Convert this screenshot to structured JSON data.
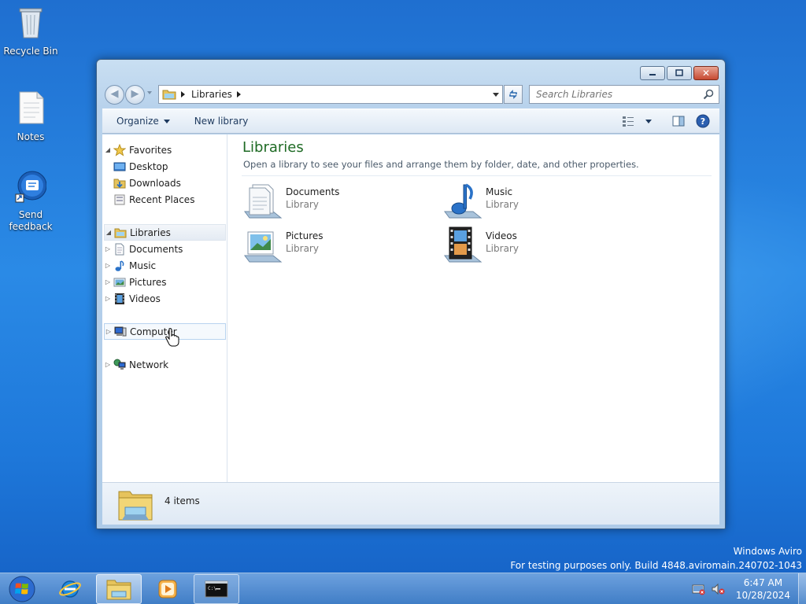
{
  "desktop": {
    "icons": [
      {
        "label": "Recycle Bin",
        "icon": "recycle-bin-icon"
      },
      {
        "label": "Notes",
        "icon": "text-document-icon"
      },
      {
        "label": "Send feedback",
        "icon": "feedback-icon"
      }
    ],
    "watermark": {
      "line1": "Windows Aviro",
      "line2": "For testing purposes only. Build 4848.aviromain.240702-1043"
    }
  },
  "window": {
    "address": {
      "crumb": "Libraries"
    },
    "search": {
      "placeholder": "Search Libraries"
    },
    "toolbar": {
      "organize": "Organize",
      "new_library": "New library"
    },
    "nav": {
      "favorites": {
        "label": "Favorites",
        "items": [
          "Desktop",
          "Downloads",
          "Recent Places"
        ]
      },
      "libraries": {
        "label": "Libraries",
        "items": [
          "Documents",
          "Music",
          "Pictures",
          "Videos"
        ]
      },
      "computer": "Computer",
      "network": "Network"
    },
    "main": {
      "title": "Libraries",
      "subtitle": "Open a library to see your files and arrange them by folder, date, and other properties.",
      "libraries": [
        {
          "name": "Documents",
          "type": "Library",
          "icon": "documents-library-icon"
        },
        {
          "name": "Music",
          "type": "Library",
          "icon": "music-library-icon"
        },
        {
          "name": "Pictures",
          "type": "Library",
          "icon": "pictures-library-icon"
        },
        {
          "name": "Videos",
          "type": "Library",
          "icon": "videos-library-icon"
        }
      ]
    },
    "details": {
      "count": "4 items"
    }
  },
  "taskbar": {
    "apps": [
      "start-orb-icon",
      "internet-explorer-icon",
      "file-explorer-icon",
      "media-player-icon",
      "command-prompt-icon"
    ],
    "clock": {
      "time": "6:47 AM",
      "date": "10/28/2024"
    }
  },
  "colors": {
    "accent_title": "#1e6a24",
    "desktop_blue": "#2a8ae6"
  }
}
